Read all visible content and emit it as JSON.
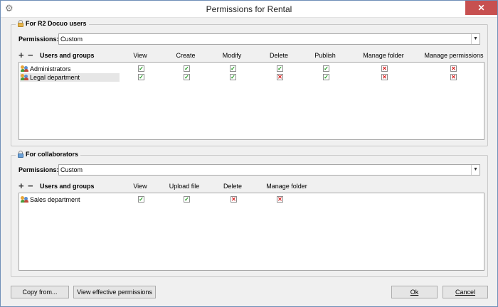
{
  "window": {
    "title": "Permissions for Rental",
    "close_glyph": "✕",
    "settings_icon": "gear-icon"
  },
  "r2": {
    "legend": "For R2 Docuo users",
    "permissions_label": "Permissions:",
    "permissions_value": "Custom",
    "add_glyph": "+",
    "remove_glyph": "−",
    "columns": [
      "Users and groups",
      "View",
      "Create",
      "Modify",
      "Delete",
      "Publish",
      "Manage folder",
      "Manage permissions"
    ],
    "rows": [
      {
        "name": "Administrators",
        "values": [
          true,
          true,
          true,
          true,
          true,
          false,
          false
        ]
      },
      {
        "name": "Legal department",
        "values": [
          true,
          true,
          true,
          false,
          true,
          false,
          false
        ]
      }
    ]
  },
  "collab": {
    "legend": "For collaborators",
    "permissions_label": "Permissions:",
    "permissions_value": "Custom",
    "add_glyph": "+",
    "remove_glyph": "−",
    "columns": [
      "Users and groups",
      "View",
      "Upload file",
      "Delete",
      "Manage folder"
    ],
    "rows": [
      {
        "name": "Sales department",
        "values": [
          true,
          true,
          false,
          false
        ]
      }
    ]
  },
  "buttons": {
    "copy_from": "Copy from...",
    "effective": "View effective permissions",
    "ok": "Ok",
    "cancel": "Cancel"
  },
  "glyphs": {
    "check": "✓",
    "cross": "✕",
    "dropdown": "▼"
  }
}
